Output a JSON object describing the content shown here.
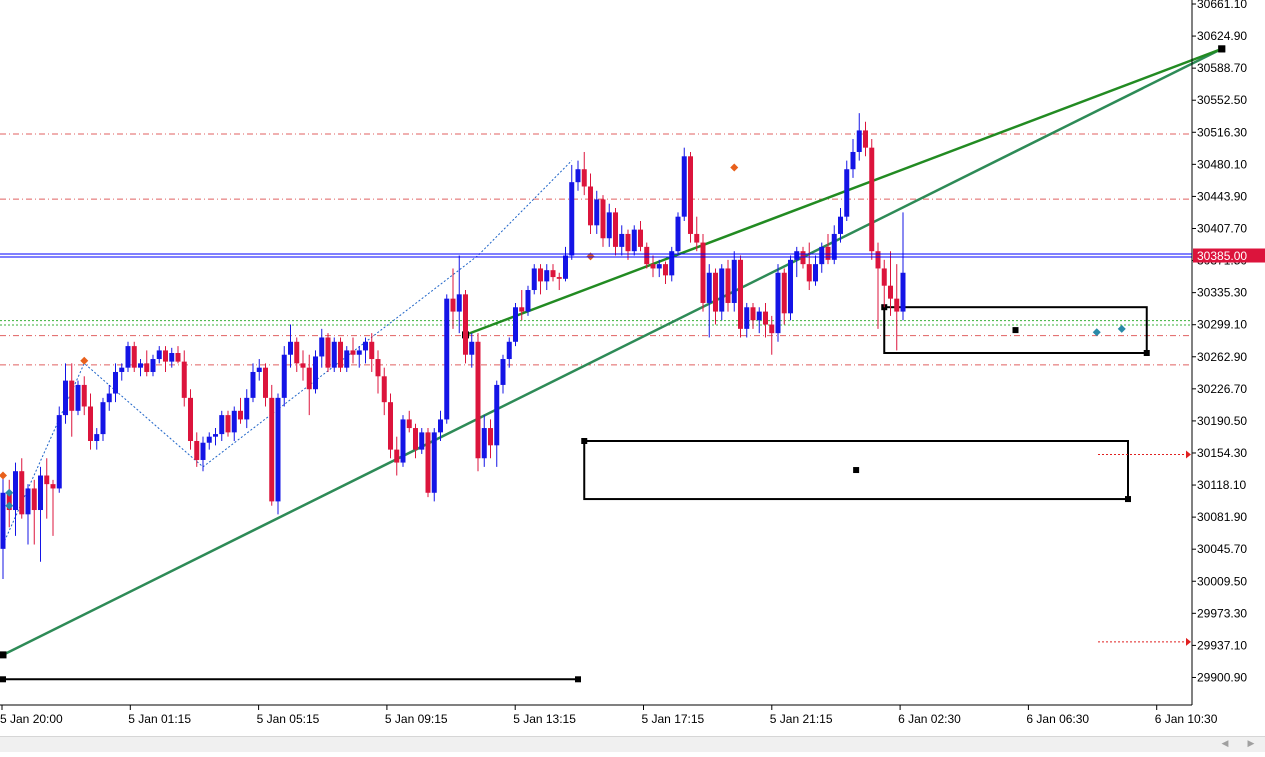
{
  "colors": {
    "bull": "#1414e6",
    "bear": "#dc143c",
    "wick": "#606060",
    "trend": "#2e8b57",
    "trend_upper": "#228b22",
    "level": "#e06060",
    "support": "#38b038",
    "price_line": "#0000ff",
    "price_tag": "#dc143c",
    "zigzag": "#1e64c8",
    "box": "#000000"
  },
  "price_tag": "30385.00",
  "chart_data": {
    "type": "candlestick",
    "title": "",
    "xlabel": "",
    "ylabel": "",
    "ylim": [
      29864,
      30680
    ],
    "y_ticks": [
      "30661.10",
      "30624.90",
      "30588.70",
      "30552.50",
      "30516.30",
      "30480.10",
      "30443.90",
      "30407.70",
      "30371.50",
      "30335.30",
      "30299.10",
      "30262.90",
      "30226.70",
      "30190.50",
      "30154.30",
      "30118.10",
      "30081.90",
      "30045.70",
      "30009.50",
      "29973.30",
      "29937.10",
      "29900.90"
    ],
    "x_ticks": [
      "5 Jan 20:00",
      "5 Jan 01:15",
      "5 Jan 05:15",
      "5 Jan 09:15",
      "5 Jan 13:15",
      "5 Jan 17:15",
      "5 Jan 21:15",
      "6 Jan 02:30",
      "6 Jan 06:30",
      "6 Jan 10:30"
    ],
    "current_price": 30385.0,
    "candles": [
      {
        "o": 30045,
        "h": 30130,
        "l": 30010,
        "c": 30110
      },
      {
        "o": 30110,
        "h": 30125,
        "l": 30070,
        "c": 30090
      },
      {
        "o": 30090,
        "h": 30145,
        "l": 30060,
        "c": 30135
      },
      {
        "o": 30135,
        "h": 30150,
        "l": 30080,
        "c": 30085
      },
      {
        "o": 30085,
        "h": 30120,
        "l": 30050,
        "c": 30115
      },
      {
        "o": 30115,
        "h": 30125,
        "l": 30050,
        "c": 30090
      },
      {
        "o": 30090,
        "h": 30140,
        "l": 30030,
        "c": 30130
      },
      {
        "o": 30130,
        "h": 30150,
        "l": 30080,
        "c": 30120
      },
      {
        "o": 30120,
        "h": 30125,
        "l": 30060,
        "c": 30115
      },
      {
        "o": 30115,
        "h": 30210,
        "l": 30110,
        "c": 30200
      },
      {
        "o": 30200,
        "h": 30260,
        "l": 30190,
        "c": 30240
      },
      {
        "o": 30240,
        "h": 30260,
        "l": 30175,
        "c": 30205
      },
      {
        "o": 30205,
        "h": 30240,
        "l": 30200,
        "c": 30235
      },
      {
        "o": 30235,
        "h": 30245,
        "l": 30200,
        "c": 30210
      },
      {
        "o": 30210,
        "h": 30225,
        "l": 30160,
        "c": 30170
      },
      {
        "o": 30170,
        "h": 30185,
        "l": 30160,
        "c": 30178
      },
      {
        "o": 30178,
        "h": 30220,
        "l": 30170,
        "c": 30215
      },
      {
        "o": 30215,
        "h": 30235,
        "l": 30205,
        "c": 30225
      },
      {
        "o": 30225,
        "h": 30260,
        "l": 30215,
        "c": 30250
      },
      {
        "o": 30250,
        "h": 30260,
        "l": 30240,
        "c": 30255
      },
      {
        "o": 30255,
        "h": 30285,
        "l": 30250,
        "c": 30280
      },
      {
        "o": 30280,
        "h": 30285,
        "l": 30250,
        "c": 30255
      },
      {
        "o": 30255,
        "h": 30265,
        "l": 30245,
        "c": 30260
      },
      {
        "o": 30260,
        "h": 30275,
        "l": 30245,
        "c": 30250
      },
      {
        "o": 30250,
        "h": 30270,
        "l": 30245,
        "c": 30265
      },
      {
        "o": 30265,
        "h": 30280,
        "l": 30260,
        "c": 30275
      },
      {
        "o": 30275,
        "h": 30280,
        "l": 30250,
        "c": 30262
      },
      {
        "o": 30262,
        "h": 30278,
        "l": 30255,
        "c": 30272
      },
      {
        "o": 30272,
        "h": 30280,
        "l": 30260,
        "c": 30262
      },
      {
        "o": 30262,
        "h": 30275,
        "l": 30210,
        "c": 30220
      },
      {
        "o": 30220,
        "h": 30230,
        "l": 30160,
        "c": 30170
      },
      {
        "o": 30170,
        "h": 30180,
        "l": 30140,
        "c": 30148
      },
      {
        "o": 30148,
        "h": 30175,
        "l": 30135,
        "c": 30168
      },
      {
        "o": 30168,
        "h": 30180,
        "l": 30160,
        "c": 30175
      },
      {
        "o": 30175,
        "h": 30185,
        "l": 30165,
        "c": 30178
      },
      {
        "o": 30178,
        "h": 30205,
        "l": 30170,
        "c": 30200
      },
      {
        "o": 30200,
        "h": 30205,
        "l": 30175,
        "c": 30180
      },
      {
        "o": 30180,
        "h": 30210,
        "l": 30170,
        "c": 30205
      },
      {
        "o": 30205,
        "h": 30220,
        "l": 30190,
        "c": 30195
      },
      {
        "o": 30195,
        "h": 30230,
        "l": 30185,
        "c": 30220
      },
      {
        "o": 30220,
        "h": 30260,
        "l": 30215,
        "c": 30250
      },
      {
        "o": 30250,
        "h": 30265,
        "l": 30240,
        "c": 30255
      },
      {
        "o": 30255,
        "h": 30260,
        "l": 30210,
        "c": 30220
      },
      {
        "o": 30220,
        "h": 30235,
        "l": 30095,
        "c": 30100
      },
      {
        "o": 30100,
        "h": 30225,
        "l": 30085,
        "c": 30220
      },
      {
        "o": 30220,
        "h": 30280,
        "l": 30210,
        "c": 30270
      },
      {
        "o": 30270,
        "h": 30305,
        "l": 30255,
        "c": 30285
      },
      {
        "o": 30285,
        "h": 30290,
        "l": 30250,
        "c": 30260
      },
      {
        "o": 30260,
        "h": 30275,
        "l": 30240,
        "c": 30255
      },
      {
        "o": 30255,
        "h": 30270,
        "l": 30200,
        "c": 30230
      },
      {
        "o": 30230,
        "h": 30275,
        "l": 30225,
        "c": 30268
      },
      {
        "o": 30268,
        "h": 30300,
        "l": 30255,
        "c": 30290
      },
      {
        "o": 30290,
        "h": 30295,
        "l": 30250,
        "c": 30255
      },
      {
        "o": 30255,
        "h": 30290,
        "l": 30250,
        "c": 30285
      },
      {
        "o": 30285,
        "h": 30290,
        "l": 30250,
        "c": 30255
      },
      {
        "o": 30255,
        "h": 30280,
        "l": 30250,
        "c": 30275
      },
      {
        "o": 30275,
        "h": 30290,
        "l": 30260,
        "c": 30270
      },
      {
        "o": 30270,
        "h": 30280,
        "l": 30255,
        "c": 30275
      },
      {
        "o": 30275,
        "h": 30290,
        "l": 30260,
        "c": 30285
      },
      {
        "o": 30285,
        "h": 30295,
        "l": 30250,
        "c": 30265
      },
      {
        "o": 30265,
        "h": 30275,
        "l": 30225,
        "c": 30245
      },
      {
        "o": 30245,
        "h": 30255,
        "l": 30200,
        "c": 30215
      },
      {
        "o": 30215,
        "h": 30225,
        "l": 30150,
        "c": 30160
      },
      {
        "o": 30160,
        "h": 30175,
        "l": 30130,
        "c": 30145
      },
      {
        "o": 30145,
        "h": 30200,
        "l": 30140,
        "c": 30195
      },
      {
        "o": 30195,
        "h": 30205,
        "l": 30180,
        "c": 30185
      },
      {
        "o": 30185,
        "h": 30190,
        "l": 30150,
        "c": 30160
      },
      {
        "o": 30160,
        "h": 30185,
        "l": 30155,
        "c": 30180
      },
      {
        "o": 30180,
        "h": 30185,
        "l": 30105,
        "c": 30110
      },
      {
        "o": 30110,
        "h": 30185,
        "l": 30100,
        "c": 30180
      },
      {
        "o": 30180,
        "h": 30205,
        "l": 30170,
        "c": 30195
      },
      {
        "o": 30195,
        "h": 30340,
        "l": 30190,
        "c": 30335
      },
      {
        "o": 30335,
        "h": 30370,
        "l": 30300,
        "c": 30320
      },
      {
        "o": 30320,
        "h": 30385,
        "l": 30295,
        "c": 30340
      },
      {
        "o": 30340,
        "h": 30345,
        "l": 30260,
        "c": 30270
      },
      {
        "o": 30270,
        "h": 30295,
        "l": 30255,
        "c": 30285
      },
      {
        "o": 30285,
        "h": 30295,
        "l": 30135,
        "c": 30150
      },
      {
        "o": 30150,
        "h": 30200,
        "l": 30140,
        "c": 30185
      },
      {
        "o": 30185,
        "h": 30195,
        "l": 30150,
        "c": 30165
      },
      {
        "o": 30165,
        "h": 30240,
        "l": 30140,
        "c": 30235
      },
      {
        "o": 30235,
        "h": 30270,
        "l": 30225,
        "c": 30265
      },
      {
        "o": 30265,
        "h": 30290,
        "l": 30255,
        "c": 30285
      },
      {
        "o": 30285,
        "h": 30330,
        "l": 30280,
        "c": 30325
      },
      {
        "o": 30325,
        "h": 30345,
        "l": 30310,
        "c": 30320
      },
      {
        "o": 30320,
        "h": 30350,
        "l": 30315,
        "c": 30345
      },
      {
        "o": 30345,
        "h": 30375,
        "l": 30340,
        "c": 30370
      },
      {
        "o": 30370,
        "h": 30375,
        "l": 30340,
        "c": 30355
      },
      {
        "o": 30355,
        "h": 30375,
        "l": 30345,
        "c": 30368
      },
      {
        "o": 30368,
        "h": 30375,
        "l": 30355,
        "c": 30360
      },
      {
        "o": 30360,
        "h": 30365,
        "l": 30345,
        "c": 30358
      },
      {
        "o": 30358,
        "h": 30395,
        "l": 30355,
        "c": 30385
      },
      {
        "o": 30385,
        "h": 30490,
        "l": 30380,
        "c": 30470
      },
      {
        "o": 30470,
        "h": 30495,
        "l": 30460,
        "c": 30485
      },
      {
        "o": 30485,
        "h": 30505,
        "l": 30455,
        "c": 30465
      },
      {
        "o": 30465,
        "h": 30480,
        "l": 30410,
        "c": 30420
      },
      {
        "o": 30420,
        "h": 30460,
        "l": 30410,
        "c": 30450
      },
      {
        "o": 30450,
        "h": 30455,
        "l": 30395,
        "c": 30405
      },
      {
        "o": 30405,
        "h": 30445,
        "l": 30395,
        "c": 30435
      },
      {
        "o": 30435,
        "h": 30440,
        "l": 30385,
        "c": 30395
      },
      {
        "o": 30395,
        "h": 30420,
        "l": 30385,
        "c": 30410
      },
      {
        "o": 30410,
        "h": 30415,
        "l": 30380,
        "c": 30390
      },
      {
        "o": 30390,
        "h": 30420,
        "l": 30385,
        "c": 30415
      },
      {
        "o": 30415,
        "h": 30425,
        "l": 30390,
        "c": 30395
      },
      {
        "o": 30395,
        "h": 30400,
        "l": 30370,
        "c": 30375
      },
      {
        "o": 30375,
        "h": 30385,
        "l": 30360,
        "c": 30370
      },
      {
        "o": 30370,
        "h": 30380,
        "l": 30360,
        "c": 30375
      },
      {
        "o": 30375,
        "h": 30378,
        "l": 30352,
        "c": 30362
      },
      {
        "o": 30362,
        "h": 30395,
        "l": 30355,
        "c": 30390
      },
      {
        "o": 30390,
        "h": 30435,
        "l": 30385,
        "c": 30430
      },
      {
        "o": 30430,
        "h": 30510,
        "l": 30425,
        "c": 30500
      },
      {
        "o": 30500,
        "h": 30505,
        "l": 30400,
        "c": 30410
      },
      {
        "o": 30410,
        "h": 30430,
        "l": 30390,
        "c": 30400
      },
      {
        "o": 30400,
        "h": 30410,
        "l": 30320,
        "c": 30330
      },
      {
        "o": 30330,
        "h": 30375,
        "l": 30290,
        "c": 30365
      },
      {
        "o": 30365,
        "h": 30370,
        "l": 30305,
        "c": 30320
      },
      {
        "o": 30320,
        "h": 30375,
        "l": 30310,
        "c": 30370
      },
      {
        "o": 30370,
        "h": 30380,
        "l": 30320,
        "c": 30330
      },
      {
        "o": 30330,
        "h": 30390,
        "l": 30320,
        "c": 30380
      },
      {
        "o": 30380,
        "h": 30385,
        "l": 30290,
        "c": 30300
      },
      {
        "o": 30300,
        "h": 30330,
        "l": 30290,
        "c": 30325
      },
      {
        "o": 30325,
        "h": 30330,
        "l": 30300,
        "c": 30310
      },
      {
        "o": 30310,
        "h": 30325,
        "l": 30295,
        "c": 30320
      },
      {
        "o": 30320,
        "h": 30330,
        "l": 30290,
        "c": 30305
      },
      {
        "o": 30305,
        "h": 30315,
        "l": 30270,
        "c": 30295
      },
      {
        "o": 30295,
        "h": 30375,
        "l": 30285,
        "c": 30365
      },
      {
        "o": 30365,
        "h": 30370,
        "l": 30305,
        "c": 30318
      },
      {
        "o": 30318,
        "h": 30385,
        "l": 30310,
        "c": 30380
      },
      {
        "o": 30380,
        "h": 30395,
        "l": 30360,
        "c": 30390
      },
      {
        "o": 30390,
        "h": 30395,
        "l": 30370,
        "c": 30375
      },
      {
        "o": 30375,
        "h": 30400,
        "l": 30345,
        "c": 30355
      },
      {
        "o": 30355,
        "h": 30385,
        "l": 30350,
        "c": 30375
      },
      {
        "o": 30375,
        "h": 30400,
        "l": 30365,
        "c": 30395
      },
      {
        "o": 30395,
        "h": 30410,
        "l": 30375,
        "c": 30380
      },
      {
        "o": 30380,
        "h": 30420,
        "l": 30375,
        "c": 30410
      },
      {
        "o": 30410,
        "h": 30440,
        "l": 30400,
        "c": 30430
      },
      {
        "o": 30430,
        "h": 30495,
        "l": 30425,
        "c": 30485
      },
      {
        "o": 30485,
        "h": 30520,
        "l": 30475,
        "c": 30505
      },
      {
        "o": 30505,
        "h": 30550,
        "l": 30495,
        "c": 30530
      },
      {
        "o": 30530,
        "h": 30540,
        "l": 30500,
        "c": 30510
      },
      {
        "o": 30510,
        "h": 30520,
        "l": 30380,
        "c": 30390
      },
      {
        "o": 30390,
        "h": 30400,
        "l": 30300,
        "c": 30370
      },
      {
        "o": 30370,
        "h": 30380,
        "l": 30325,
        "c": 30350
      },
      {
        "o": 30350,
        "h": 30390,
        "l": 30315,
        "c": 30335
      },
      {
        "o": 30335,
        "h": 30375,
        "l": 30275,
        "c": 30320
      },
      {
        "o": 30320,
        "h": 30435,
        "l": 30310,
        "c": 30365
      }
    ],
    "horizontal_levels": [
      30525.9,
      30450.3,
      30292.1,
      30258.3
    ],
    "support_levels": [
      30309.5,
      30304.5
    ],
    "trend_lines": [
      {
        "x1": 0,
        "y1": 29922.1,
        "x2": 195,
        "y2": 30624.5
      },
      {
        "x1": 74,
        "y1": 30293.0,
        "x2": 195,
        "y2": 30624.5
      }
    ],
    "zigzag": [
      {
        "i": 0,
        "p": 30050
      },
      {
        "i": 13,
        "p": 30260
      },
      {
        "i": 32,
        "p": 30140
      },
      {
        "i": 76,
        "p": 30385
      },
      {
        "i": 91,
        "p": 30495
      }
    ],
    "rectangles": [
      {
        "i1": 0,
        "p1": 29893.8,
        "i2": 92,
        "p2": 29893.8
      },
      {
        "i1": 93,
        "p1": 30170.0,
        "i2": 180,
        "p2": 30102.7
      },
      {
        "i1": 141,
        "p1": 30325.1,
        "i2": 183,
        "p2": 30272.0
      }
    ],
    "markers": [
      {
        "i": 0,
        "p": 30130,
        "kind": "sell"
      },
      {
        "i": 13,
        "p": 30263,
        "kind": "sell"
      },
      {
        "i": 94,
        "p": 30384,
        "kind": "sell"
      },
      {
        "i": 117,
        "p": 30487,
        "kind": "sell"
      },
      {
        "i": 1,
        "p": 30110,
        "kind": "buy"
      },
      {
        "i": 1,
        "p": 30095,
        "kind": "buy"
      },
      {
        "i": 175,
        "p": 30296,
        "kind": "buy"
      },
      {
        "i": 179,
        "p": 30300,
        "kind": "buy"
      }
    ],
    "arrows": [
      30154.3,
      29937.1
    ]
  }
}
